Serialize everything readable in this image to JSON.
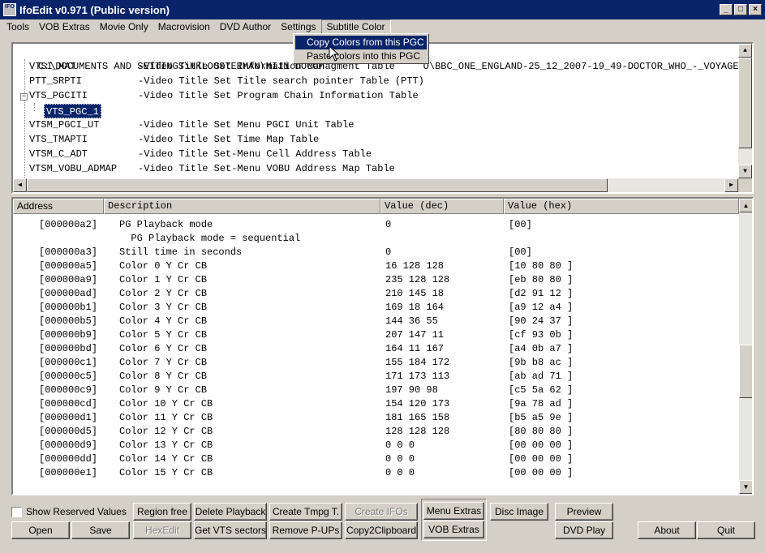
{
  "window": {
    "title": "IfoEdit v0.971 (Public version)",
    "icon": "ifo-app-icon",
    "icon_text": "IFO\nEdit"
  },
  "menu": [
    "Tools",
    "VOB Extras",
    "Movie Only",
    "Macrovision",
    "DVD Author",
    "Settings",
    "Subtitle Color"
  ],
  "subtitle_menu": [
    "Copy Colors from this PGC",
    "Paste colors into this PGC"
  ],
  "tree": {
    "path": "C:\\DOCUMENTS AND SETTINGS\\HKLOOSTERMAN\\MIJN DOCUM",
    "path_suffix": "O\\BBC_ONE_ENGLAND-25_12_2007-19_49-DOCTOR_WHO_-_VOYAGE",
    "items": [
      {
        "label": "VTSI_MAT",
        "desc": "-Video Title Set Information Managment Table"
      },
      {
        "label": "PTT_SRPTI",
        "desc": "-Video Title Set Title search pointer Table (PTT)"
      },
      {
        "label": "VTS_PGCITI",
        "desc": "-Video Title Set Program Chain Information Table"
      },
      {
        "label": "VTS_PGC_1",
        "desc": ""
      },
      {
        "label": "VTSM_PGCI_UT",
        "desc": "-Video Title Set Menu PGCI Unit Table"
      },
      {
        "label": "VTS_TMAPTI",
        "desc": "-Video Title Set Time Map Table"
      },
      {
        "label": "VTSM_C_ADT",
        "desc": "-Video Title Set-Menu Cell Address Table"
      },
      {
        "label": "VTSM_VOBU_ADMAP",
        "desc": "-Video Title Set-Menu VOBU Address Map Table"
      }
    ]
  },
  "table": {
    "columns": [
      "Address",
      "Description",
      "Value (dec)",
      "Value (hex)"
    ],
    "rows": [
      {
        "addr": "[000000a2]",
        "desc": "PG Playback mode",
        "dec": "0",
        "hex": "[00]"
      },
      {
        "addr": "",
        "desc": "  PG Playback mode = sequential",
        "dec": "",
        "hex": ""
      },
      {
        "addr": "[000000a3]",
        "desc": "Still time in seconds",
        "dec": "0",
        "hex": "[00]"
      },
      {
        "addr": "[000000a5]",
        "desc": "Color 0 Y Cr CB",
        "dec": "16 128 128",
        "hex": "[10 80 80 ]"
      },
      {
        "addr": "[000000a9]",
        "desc": "Color 1 Y Cr CB",
        "dec": "235 128 128",
        "hex": "[eb 80 80 ]"
      },
      {
        "addr": "[000000ad]",
        "desc": "Color 2 Y Cr CB",
        "dec": "210 145 18",
        "hex": "[d2 91 12 ]"
      },
      {
        "addr": "[000000b1]",
        "desc": "Color 3 Y Cr CB",
        "dec": "169 18 164",
        "hex": "[a9 12 a4 ]"
      },
      {
        "addr": "[000000b5]",
        "desc": "Color 4 Y Cr CB",
        "dec": "144 36 55",
        "hex": "[90 24 37 ]"
      },
      {
        "addr": "[000000b9]",
        "desc": "Color 5 Y Cr CB",
        "dec": "207 147 11",
        "hex": "[cf 93 0b ]"
      },
      {
        "addr": "[000000bd]",
        "desc": "Color 6 Y Cr CB",
        "dec": "164 11 167",
        "hex": "[a4 0b a7 ]"
      },
      {
        "addr": "[000000c1]",
        "desc": "Color 7 Y Cr CB",
        "dec": "155 184 172",
        "hex": "[9b b8 ac ]"
      },
      {
        "addr": "[000000c5]",
        "desc": "Color 8 Y Cr CB",
        "dec": "171 173 113",
        "hex": "[ab ad 71 ]"
      },
      {
        "addr": "[000000c9]",
        "desc": "Color 9 Y Cr CB",
        "dec": "197 90 98",
        "hex": "[c5 5a 62 ]"
      },
      {
        "addr": "[000000cd]",
        "desc": "Color 10 Y Cr CB",
        "dec": "154 120 173",
        "hex": "[9a 78 ad ]"
      },
      {
        "addr": "[000000d1]",
        "desc": "Color 11 Y Cr CB",
        "dec": "181 165 158",
        "hex": "[b5 a5 9e ]"
      },
      {
        "addr": "[000000d5]",
        "desc": "Color 12 Y Cr CB",
        "dec": "128 128 128",
        "hex": "[80 80 80 ]"
      },
      {
        "addr": "[000000d9]",
        "desc": "Color 13 Y Cr CB",
        "dec": "0 0 0",
        "hex": "[00 00 00 ]"
      },
      {
        "addr": "[000000dd]",
        "desc": "Color 14 Y Cr CB",
        "dec": "0 0 0",
        "hex": "[00 00 00 ]"
      },
      {
        "addr": "[000000e1]",
        "desc": "Color 15 Y Cr CB",
        "dec": "0 0 0",
        "hex": "[00 00 00 ]"
      }
    ]
  },
  "buttons": {
    "show_reserved": "Show Reserved Values",
    "region_free": "Region free",
    "delete_playback": "Delete Playback",
    "create_tmpg": "Create Tmpg T.",
    "create_ifos": "Create IFOs",
    "menu_extras": "Menu Extras",
    "disc_image": "Disc Image",
    "preview": "Preview",
    "open": "Open",
    "save": "Save",
    "hexedit": "HexEdit",
    "get_vts": "Get VTS sectors",
    "remove_pups": "Remove P-UPs",
    "copy2clip": "Copy2Clipboard",
    "vob_extras": "VOB Extras",
    "dvd_play": "DVD Play",
    "about": "About",
    "quit": "Quit"
  },
  "colors": {
    "titlebar": "#0a246a",
    "face": "#d4d0c8",
    "highlight": "#0a246a"
  }
}
